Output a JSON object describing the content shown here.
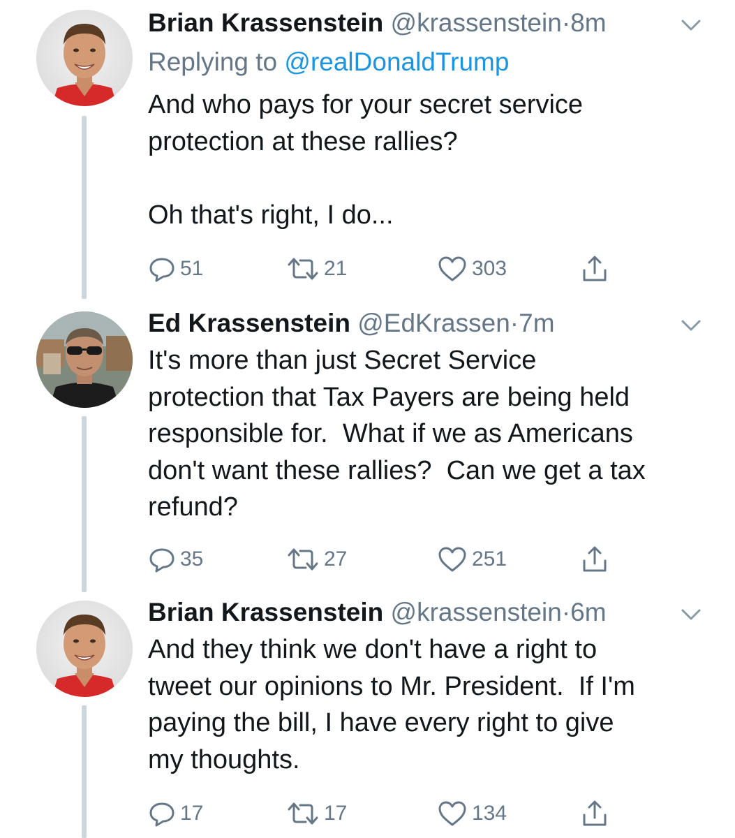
{
  "tweets": [
    {
      "name": "Brian Krassenstein",
      "handle": "@krassenstein",
      "separator": "·",
      "time": "8m",
      "replying_prefix": "Replying to ",
      "replying_to": "@realDonaldTrump",
      "text": [
        "And who pays for your secret service",
        "protection at these rallies?",
        "",
        "Oh that's right, I do..."
      ],
      "replies": "51",
      "retweets": "21",
      "likes": "303"
    },
    {
      "name": "Ed Krassenstein",
      "handle": "@EdKrassen",
      "separator": "·",
      "time": "7m",
      "text": [
        "It's more than just Secret Service",
        "protection that Tax Payers are being held",
        "responsible for.  What if we as Americans",
        "don't want these rallies?  Can we get a tax",
        "refund?"
      ],
      "replies": "35",
      "retweets": "27",
      "likes": "251"
    },
    {
      "name": "Brian Krassenstein",
      "handle": "@krassenstein",
      "separator": "·",
      "time": "6m",
      "text": [
        "And they think we don't have a right to",
        "tweet our opinions to Mr. President.  If I'm",
        "paying the bill, I have every right to give",
        "my thoughts."
      ],
      "replies": "17",
      "retweets": "17",
      "likes": "134"
    }
  ],
  "icons": {
    "reply": "reply-icon",
    "retweet": "retweet-icon",
    "like": "heart-icon",
    "share": "share-icon",
    "more": "chevron-down-icon"
  },
  "colors": {
    "text": "#14171a",
    "secondary": "#657786",
    "link": "#1b95e0",
    "thread_line": "#ccd6dd"
  }
}
